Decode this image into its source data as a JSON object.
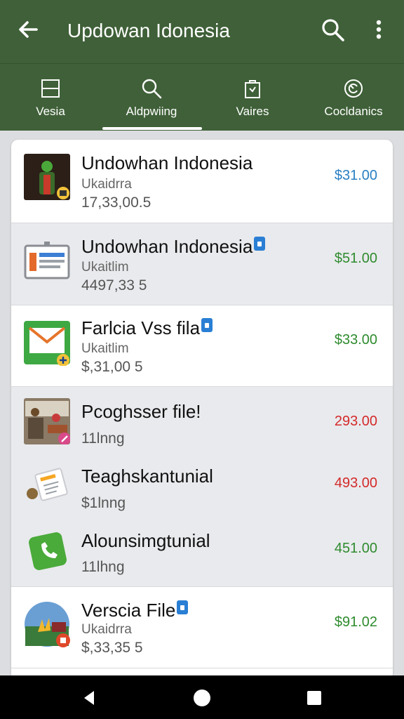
{
  "appbar": {
    "title": "Updowan Idonesia"
  },
  "tabs": [
    {
      "label": "Vesia",
      "icon": "square-window-icon"
    },
    {
      "label": "Aldpwiing",
      "icon": "search-icon",
      "selected": true
    },
    {
      "label": "Vaires",
      "icon": "shopping-bag-icon"
    },
    {
      "label": "Cocldanics",
      "icon": "refresh-circle-icon"
    }
  ],
  "items": [
    {
      "name": "Undowhan Indonesia",
      "sub": "Ukaidrra",
      "meta": "17,33,00.5",
      "price": "$31.00",
      "price_color": "#2a7fc2",
      "lock": false
    },
    {
      "name": "Undowhan Indonesia",
      "sub": "Ukaitlim",
      "meta": "4497,33 5",
      "price": "$51.00",
      "price_color": "#2e8b2e",
      "lock": true
    },
    {
      "name": "Farlcia Vss fila",
      "sub": "Ukaitlim",
      "meta": "$,31,00 5",
      "price": "$33.00",
      "price_color": "#2e8b2e",
      "lock": true
    },
    {
      "name": "Pcoghsser file!",
      "sub": "",
      "meta": "11lnng",
      "price": "293.00",
      "price_color": "#d42a2a",
      "lock": false
    },
    {
      "name": "Teaghskantunial",
      "sub": "",
      "meta": "$1lnng",
      "price": "493.00",
      "price_color": "#d42a2a",
      "lock": false
    },
    {
      "name": "Alounsimgtunial",
      "sub": "",
      "meta": "11lhng",
      "price": "451.00",
      "price_color": "#2e8b2e",
      "lock": false
    },
    {
      "name": "Verscia File",
      "sub": "Ukaidrra",
      "meta": "$,33,35 5",
      "price": "$91.02",
      "price_color": "#2e8b2e",
      "lock": true
    }
  ]
}
